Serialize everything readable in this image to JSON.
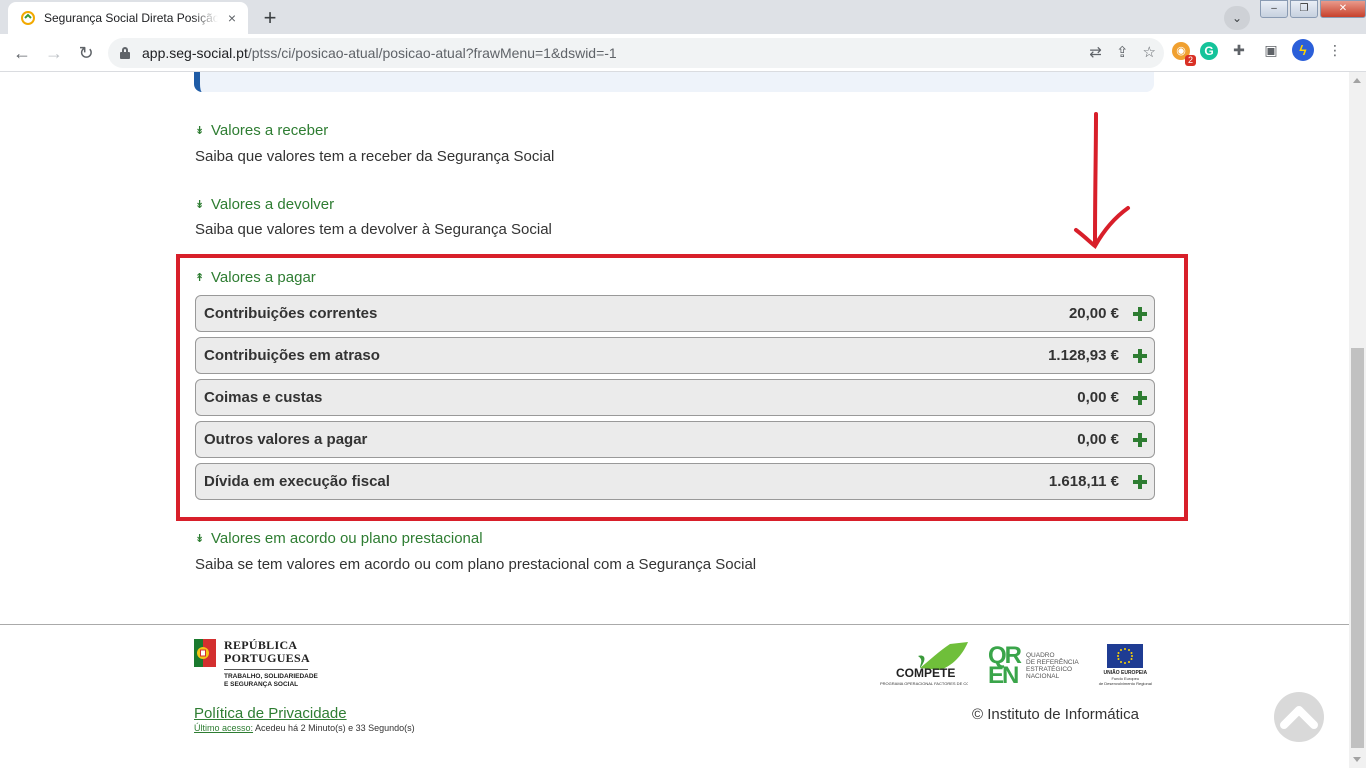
{
  "browser": {
    "tab_title": "Segurança Social Direta Posição",
    "tab_close": "×",
    "new_tab": "+",
    "url_host": "app.seg-social.pt",
    "url_path": "/ptss/ci/posicao-atual/posicao-atual?frawMenu=1&dswid=-1",
    "extension_badge": "2",
    "window_close": "✕"
  },
  "sections": {
    "receber": {
      "title": "Valores a receber",
      "desc": "Saiba que valores tem a receber da Segurança Social"
    },
    "devolver": {
      "title": "Valores a devolver",
      "desc": "Saiba que valores tem a devolver à Segurança Social"
    },
    "pagar": {
      "title": "Valores a pagar",
      "rows": [
        {
          "label": "Contribuições correntes",
          "value": "20,00 €"
        },
        {
          "label": "Contribuições em atraso",
          "value": "1.128,93 €"
        },
        {
          "label": "Coimas e custas",
          "value": "0,00 €"
        },
        {
          "label": "Outros valores a pagar",
          "value": "0,00 €"
        },
        {
          "label": "Dívida em execução fiscal",
          "value": "1.618,11 €"
        }
      ]
    },
    "acordo": {
      "title": "Valores em acordo ou plano prestacional",
      "desc": "Saiba se tem valores em acordo ou com plano prestacional com a Segurança Social"
    }
  },
  "footer": {
    "gov_name_line1": "REPÚBLICA",
    "gov_name_line2": "PORTUGUESA",
    "gov_sub_line1": "TRABALHO, SOLIDARIEDADE",
    "gov_sub_line2": "E SEGURANÇA SOCIAL",
    "privacy": "Política de Privacidade",
    "last_access_label": "Último acesso:",
    "last_access_text": " Acedeu há 2 Minuto(s) e 33 Segundo(s)",
    "copyright": "© Instituto de Informática",
    "compete": "COMPETE",
    "compete_sub": "PROGRAMA OPERACIONAL FACTORES DE COMPETITIVIDADE",
    "qren_mark_1": "QR",
    "qren_mark_2": "EN",
    "qren_line1": "QUADRO",
    "qren_line2": "DE REFERÊNCIA",
    "qren_line3": "ESTRATÉGICO",
    "qren_line4": "NACIONAL",
    "eu_label": "UNIÃO EUROPEIA",
    "eu_sub1": "Fundo Europeu",
    "eu_sub2": "de Desenvolvimento Regional"
  },
  "colors": {
    "accent_green": "#2e7d32",
    "highlight_red": "#d81f2a",
    "info_blue": "#1f5ca6"
  }
}
